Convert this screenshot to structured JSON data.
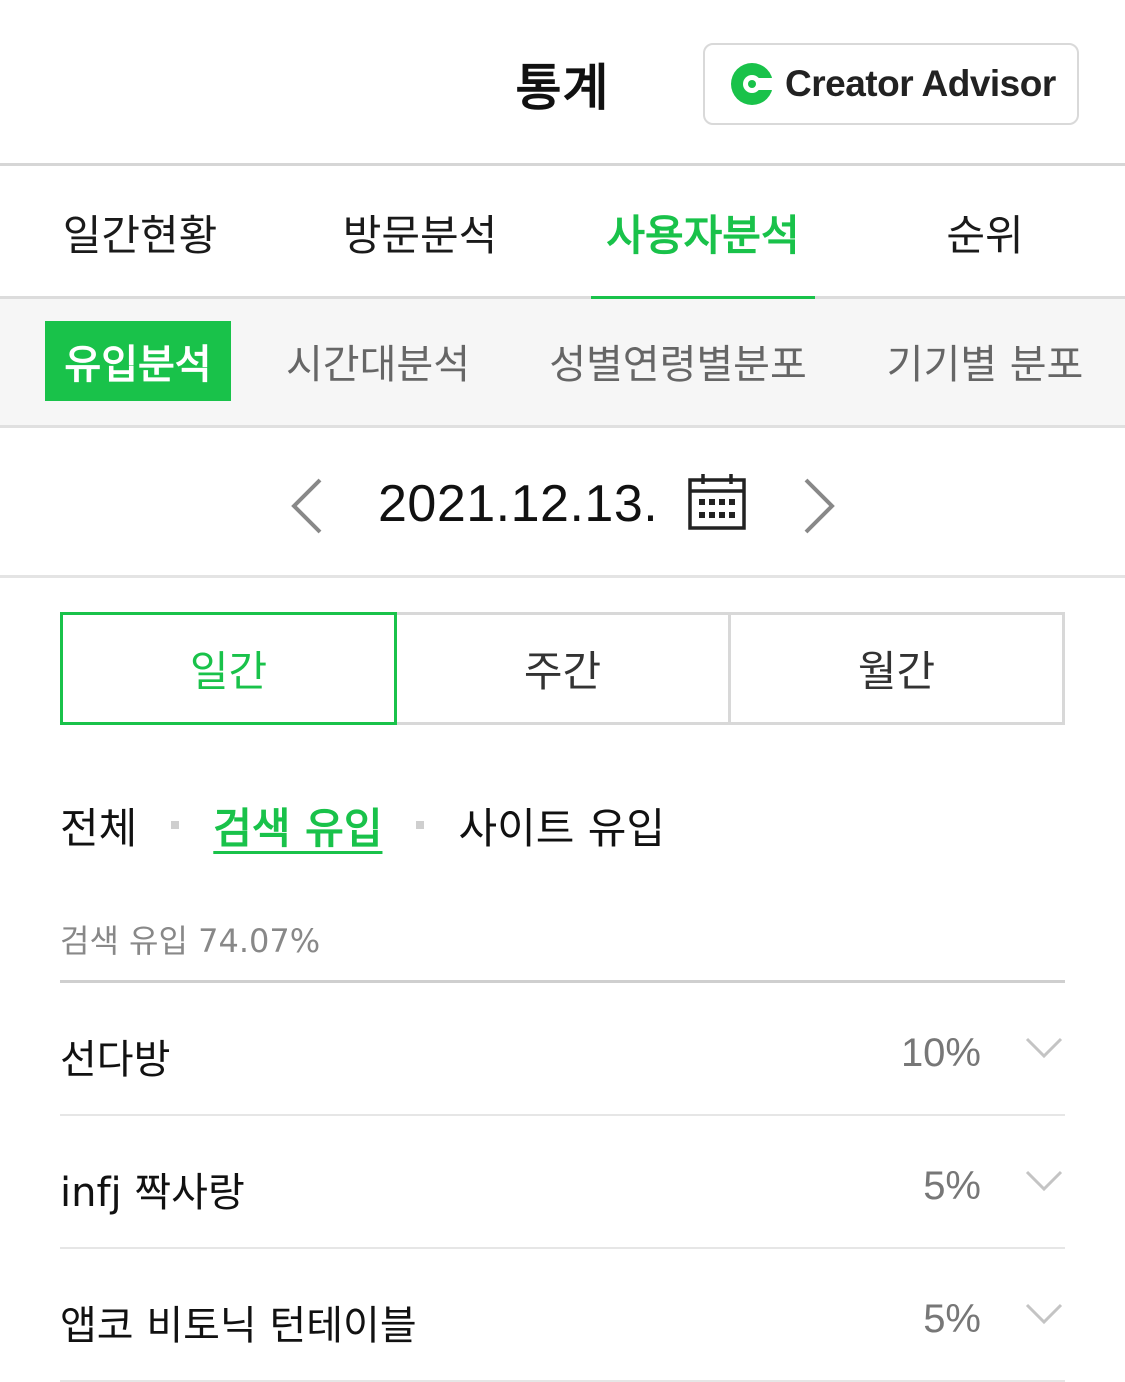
{
  "header": {
    "title": "통계",
    "creator_advisor_label": "Creator Advisor",
    "logo_icon": "creator-advisor-logo",
    "brand_color": "#19c24a"
  },
  "main_tabs": [
    {
      "label": "일간현황",
      "active": false
    },
    {
      "label": "방문분석",
      "active": false
    },
    {
      "label": "사용자분석",
      "active": true
    },
    {
      "label": "순위",
      "active": false
    }
  ],
  "sub_tabs": [
    {
      "label": "유입분석",
      "active": true
    },
    {
      "label": "시간대분석",
      "active": false
    },
    {
      "label": "성별연령별분포",
      "active": false
    },
    {
      "label": "기기별 분포",
      "active": false
    }
  ],
  "date_nav": {
    "date": "2021.12.13.",
    "prev_icon": "chevron-left-icon",
    "next_icon": "chevron-right-icon",
    "calendar_icon": "calendar-icon"
  },
  "period": [
    {
      "label": "일간",
      "active": true
    },
    {
      "label": "주간",
      "active": false
    },
    {
      "label": "월간",
      "active": false
    }
  ],
  "filters": [
    {
      "label": "전체",
      "active": false
    },
    {
      "label": "검색 유입",
      "active": true
    },
    {
      "label": "사이트 유입",
      "active": false
    }
  ],
  "summary": "검색 유입 74.07%",
  "keywords": [
    {
      "keyword": "선다방",
      "percent": "10%"
    },
    {
      "keyword": "infj 짝사랑",
      "percent": "5%"
    },
    {
      "keyword": "앱코 비토닉 턴테이블",
      "percent": "5%"
    }
  ]
}
